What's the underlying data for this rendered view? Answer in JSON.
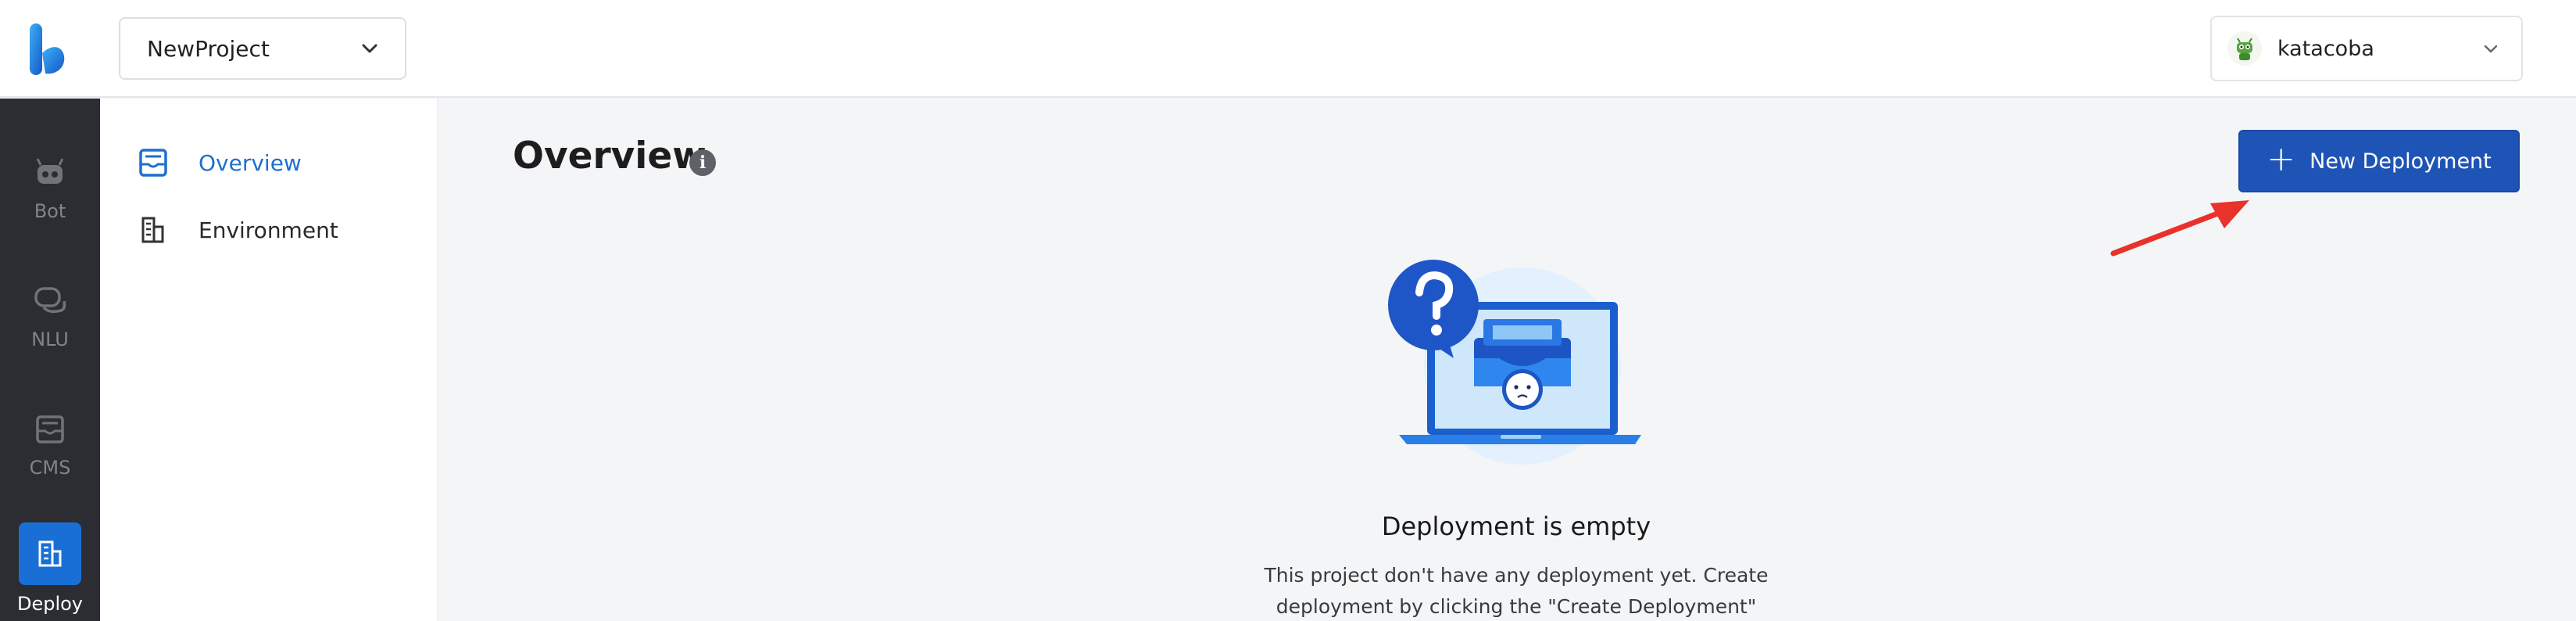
{
  "header": {
    "project": "NewProject",
    "user": "katacoba"
  },
  "rail": {
    "items": [
      {
        "label": "Bot",
        "icon": "robot-icon"
      },
      {
        "label": "NLU",
        "icon": "chat-bubbles-icon"
      },
      {
        "label": "CMS",
        "icon": "inbox-tray-icon"
      },
      {
        "label": "Deploy",
        "icon": "building-icon",
        "active": true
      }
    ]
  },
  "sidebar": {
    "items": [
      {
        "label": "Overview",
        "icon": "inbox-tray-icon",
        "active": true
      },
      {
        "label": "Environment",
        "icon": "building-icon"
      }
    ]
  },
  "main": {
    "title": "Overview",
    "new_button": "New Deployment",
    "empty_title": "Deployment is empty",
    "empty_desc_line1": "This project don't have any deployment yet. Create",
    "empty_desc_line2": "deployment by clicking the \"Create Deployment\""
  },
  "colors": {
    "accent": "#1e54b5",
    "active_blue": "#1a6fd6",
    "rail_bg": "#2b2d33",
    "annotation_arrow": "#e8322b"
  }
}
